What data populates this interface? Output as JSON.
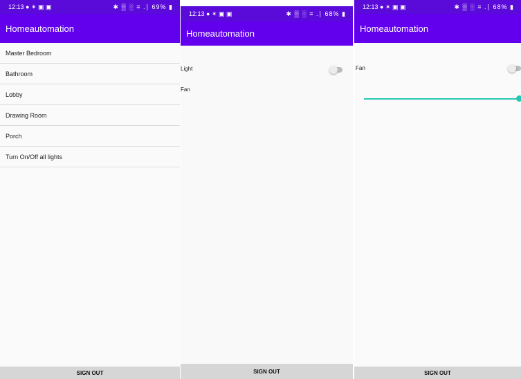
{
  "screens": [
    {
      "status": {
        "time": "12:13",
        "left_icons": "● ✶ ▣ ▣",
        "right_icons": "✱ ▒ ░ ≡ .∣ 69% ▮"
      },
      "app_title": "Homeautomation",
      "rooms": [
        "Master Bedroom",
        "Bathroom",
        "Lobby",
        "Drawing Room",
        "Porch",
        "Turn On/Off all lights"
      ],
      "sign_out": "SIGN OUT"
    },
    {
      "status": {
        "time": "12:13",
        "left_icons": "● ✶ ▣ ▣",
        "right_icons": "✱ ▒ ░ ≡ .∣ 68% ▮"
      },
      "app_title": "Homeautomation",
      "light_label": "Light",
      "light_on": false,
      "fan_label": "Fan",
      "sign_out": "SIGN OUT"
    },
    {
      "status": {
        "time": "12:13",
        "left_icons": "● ✶ ▣ ▣",
        "right_icons": "✱ ▒ ░ ≡ .∣ 68% ▮"
      },
      "app_title": "Homeautomation",
      "fan_label": "Fan",
      "fan_on": false,
      "fan_speed_fraction": 1.0,
      "sign_out": "SIGN OUT"
    }
  ],
  "colors": {
    "primary": "#6200ee",
    "status_bar": "#5a0ad9",
    "accent": "#26c6b3"
  }
}
